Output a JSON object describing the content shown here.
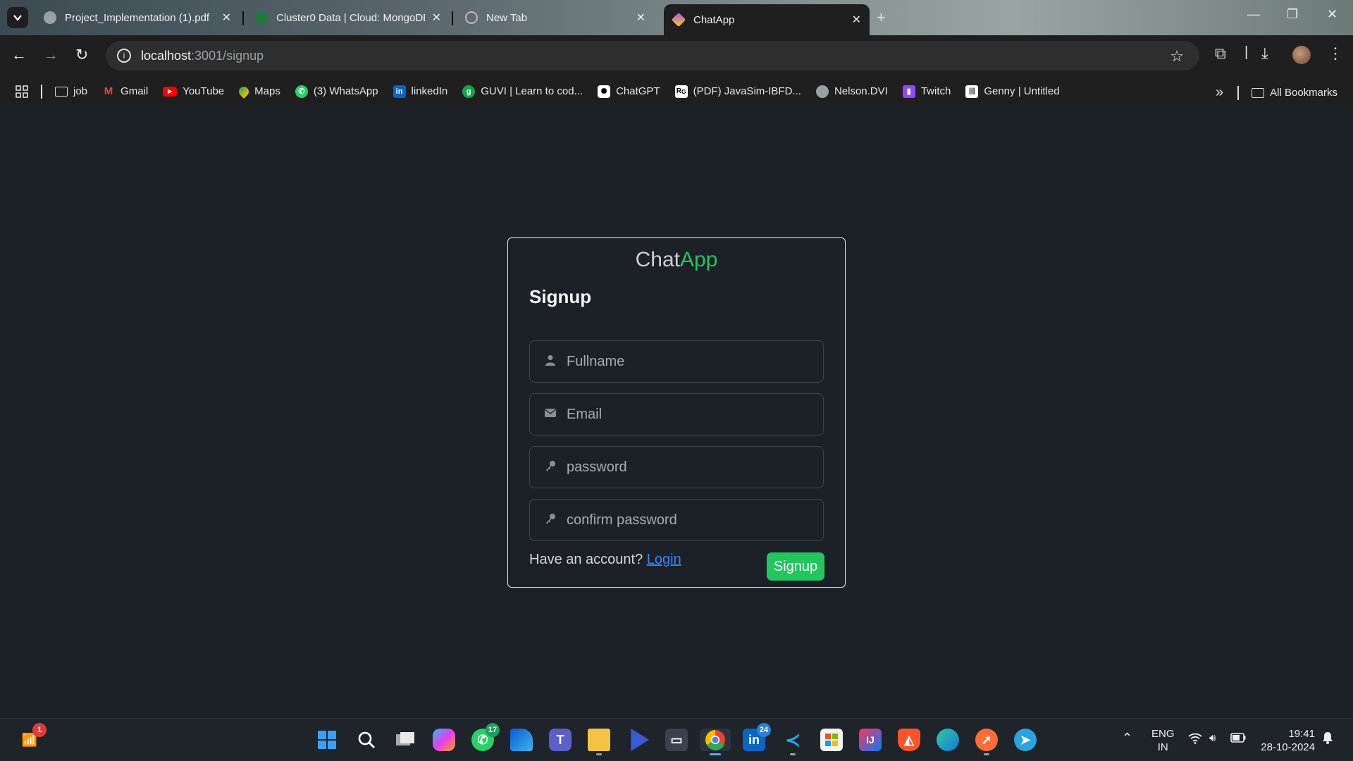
{
  "browser": {
    "tabs": [
      {
        "title": "Project_Implementation (1).pdf",
        "active": false
      },
      {
        "title": "Cluster0 Data | Cloud: MongoDB",
        "active": false
      },
      {
        "title": "New Tab",
        "active": false
      },
      {
        "title": "ChatApp",
        "active": true
      }
    ],
    "url_host": "localhost",
    "url_path": ":3001/signup"
  },
  "bookmarks": {
    "items": [
      {
        "label": "job",
        "icon": "folder-icon"
      },
      {
        "label": "Gmail",
        "icon": "gmail-icon"
      },
      {
        "label": "YouTube",
        "icon": "youtube-icon"
      },
      {
        "label": "Maps",
        "icon": "maps-icon"
      },
      {
        "label": "(3) WhatsApp",
        "icon": "whatsapp-icon"
      },
      {
        "label": "linkedIn",
        "icon": "linkedin-icon"
      },
      {
        "label": "GUVI | Learn to cod...",
        "icon": "guvi-icon"
      },
      {
        "label": "ChatGPT",
        "icon": "chatgpt-icon"
      },
      {
        "label": "(PDF) JavaSim-IBFD...",
        "icon": "researchgate-icon"
      },
      {
        "label": "Nelson.DVI",
        "icon": "globe-icon"
      },
      {
        "label": "Twitch",
        "icon": "twitch-icon"
      },
      {
        "label": "Genny | Untitled",
        "icon": "genny-icon"
      }
    ],
    "all_label": "All Bookmarks"
  },
  "app": {
    "brand_part1": "Chat",
    "brand_part2": "App",
    "heading": "Signup",
    "fields": {
      "fullname_placeholder": "Fullname",
      "email_placeholder": "Email",
      "password_placeholder": "password",
      "confirm_placeholder": "confirm password"
    },
    "footer_text": "Have an account?",
    "login_link": "Login",
    "signup_button": "Signup",
    "colors": {
      "accent": "#22c55e",
      "link": "#3b82f6",
      "background": "#1c2128"
    }
  },
  "taskbar": {
    "badges": {
      "notifications": "1",
      "whatsapp": "17",
      "linkedin": "24"
    },
    "language_top": "ENG",
    "language_bottom": "IN",
    "time": "19:41",
    "date": "28-10-2024"
  }
}
